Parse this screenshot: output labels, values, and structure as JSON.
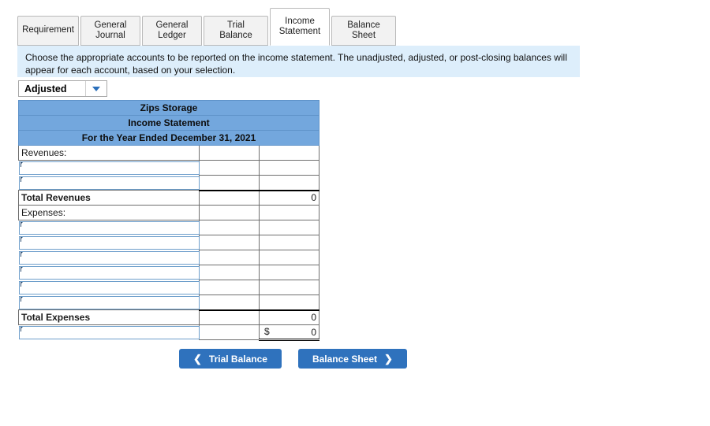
{
  "tabs": [
    {
      "label": "Requirement",
      "active": false
    },
    {
      "label": "General\nJournal",
      "active": false
    },
    {
      "label": "General\nLedger",
      "active": false
    },
    {
      "label": "Trial Balance",
      "active": false
    },
    {
      "label": "Income\nStatement",
      "active": true
    },
    {
      "label": "Balance Sheet",
      "active": false
    }
  ],
  "banner": {
    "text": "Choose the appropriate accounts to be reported on the income statement. The unadjusted, adjusted, or post-closing balances will appear for each account, based on your selection."
  },
  "selector": {
    "value": "Adjusted",
    "icon": "chevron-down-icon"
  },
  "statement": {
    "header": [
      "Zips Storage",
      "Income Statement",
      "For the Year Ended December 31, 2021"
    ],
    "revenues_label": "Revenues:",
    "revenue_inputs": [
      {
        "value": "",
        "placeholder": ""
      },
      {
        "value": "",
        "placeholder": ""
      }
    ],
    "total_revenues_label": "Total Revenues",
    "total_revenues_value": "0",
    "expenses_label": "Expenses:",
    "expense_inputs": [
      {
        "value": "",
        "placeholder": ""
      },
      {
        "value": "",
        "placeholder": ""
      },
      {
        "value": "",
        "placeholder": ""
      },
      {
        "value": "",
        "placeholder": ""
      },
      {
        "value": "",
        "placeholder": ""
      },
      {
        "value": "",
        "placeholder": ""
      }
    ],
    "total_expenses_label": "Total Expenses",
    "total_expenses_value": "0",
    "net_income_input": {
      "value": "",
      "placeholder": ""
    },
    "net_income_currency": "$",
    "net_income_value": "0"
  },
  "nav": {
    "prev_label": "Trial Balance",
    "prev_icon": "chevron-left-icon",
    "next_label": "Balance Sheet",
    "next_icon": "chevron-right-icon"
  },
  "colors": {
    "header_blue": "#73a7dd",
    "banner_blue": "#ddeefb",
    "button_blue": "#2f72bd",
    "input_border": "#6d9ecb"
  }
}
